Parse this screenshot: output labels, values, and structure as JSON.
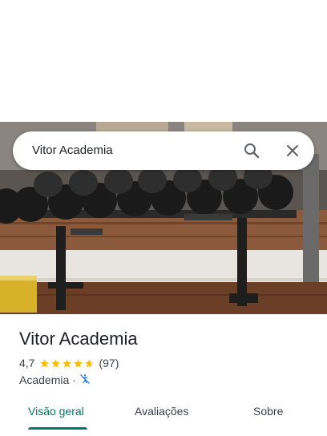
{
  "search": {
    "query": "Vitor Academia"
  },
  "place": {
    "name": "Vitor Academia",
    "rating": "4,7",
    "stars": 4.7,
    "reviews": "(97)",
    "category": "Academia",
    "separator": "·"
  },
  "tabs": [
    {
      "label": "Visão geral",
      "active": true
    },
    {
      "label": "Avaliações",
      "active": false
    },
    {
      "label": "Sobre",
      "active": false
    }
  ],
  "colors": {
    "accent": "#00796b",
    "star": "#fbbc04",
    "accessibility": "#1a73e8"
  }
}
